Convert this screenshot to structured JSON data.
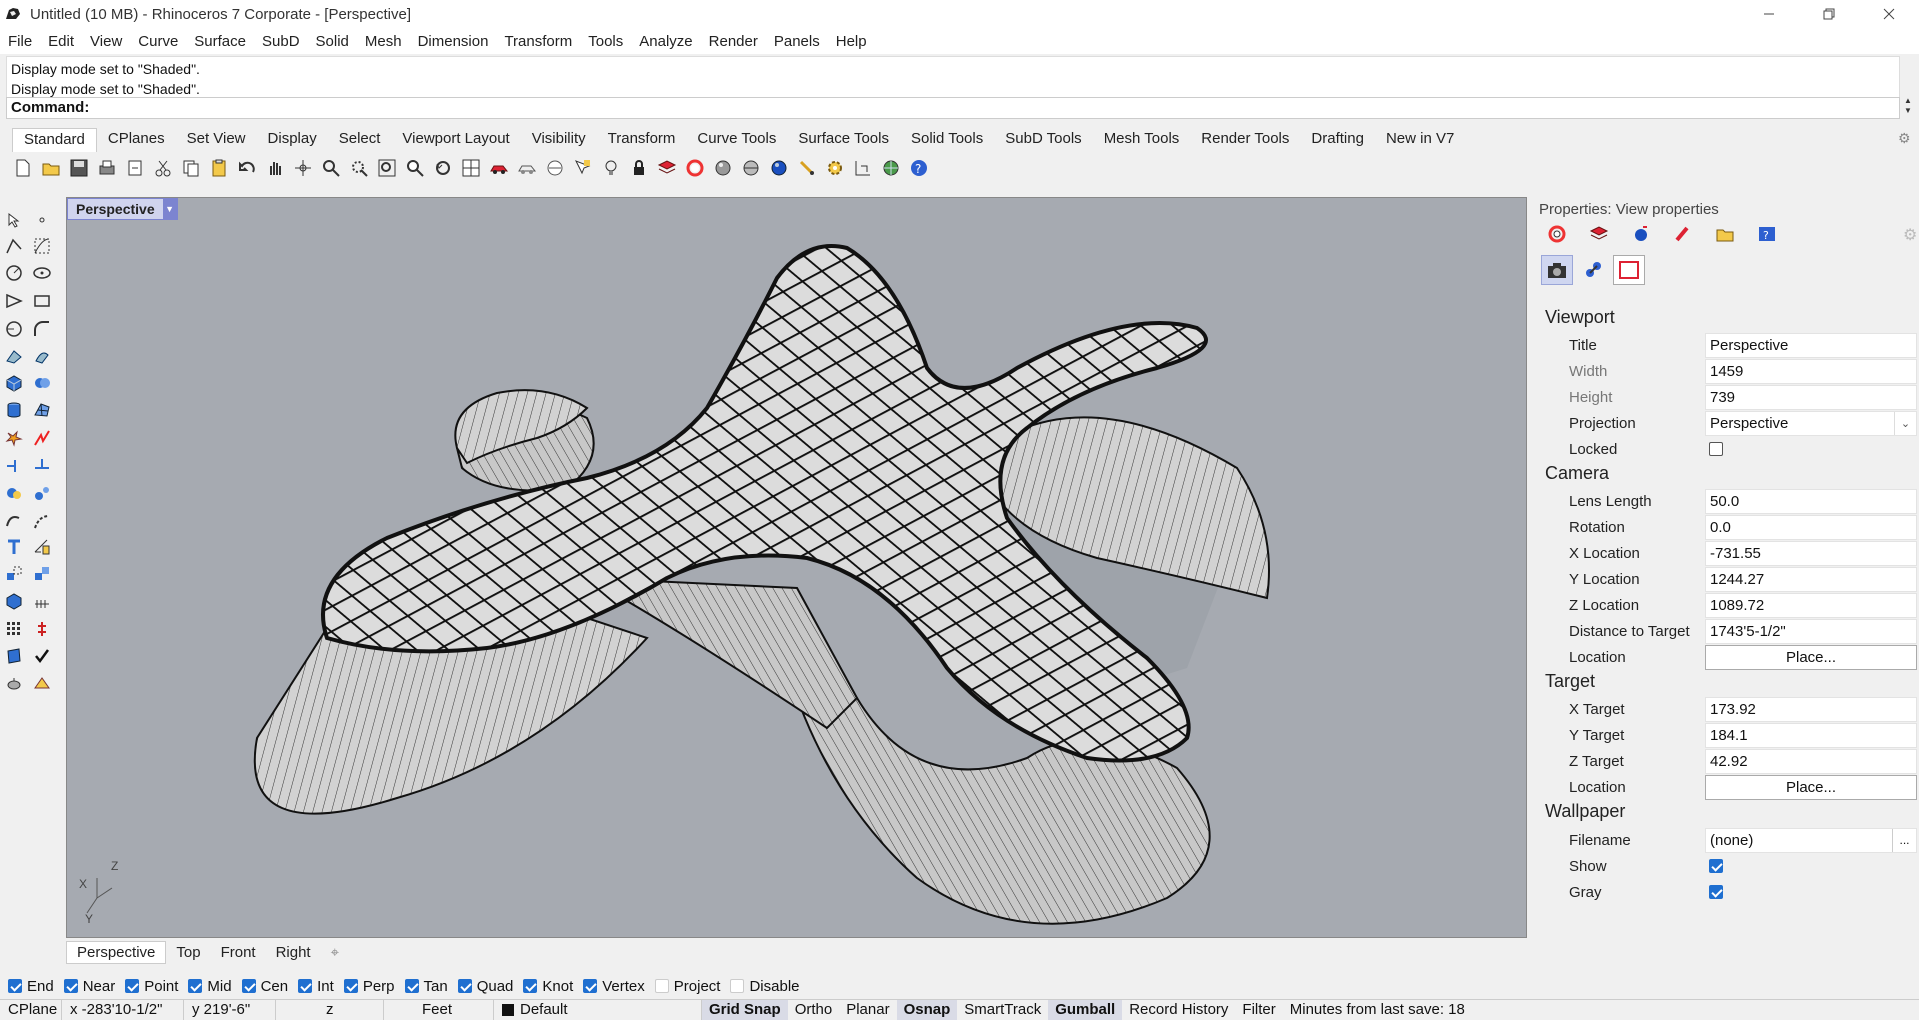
{
  "window": {
    "title": "Untitled (10 MB) - Rhinoceros 7 Corporate - [Perspective]"
  },
  "menu": [
    "File",
    "Edit",
    "View",
    "Curve",
    "Surface",
    "SubD",
    "Solid",
    "Mesh",
    "Dimension",
    "Transform",
    "Tools",
    "Analyze",
    "Render",
    "Panels",
    "Help"
  ],
  "command_history": [
    "Display mode set to \"Shaded\".",
    "Display mode set to \"Shaded\"."
  ],
  "command_prompt": "Command:",
  "toolbar_tabs": [
    "Standard",
    "CPlanes",
    "Set View",
    "Display",
    "Select",
    "Viewport Layout",
    "Visibility",
    "Transform",
    "Curve Tools",
    "Surface Tools",
    "Solid Tools",
    "SubD Tools",
    "Mesh Tools",
    "Render Tools",
    "Drafting",
    "New in V7"
  ],
  "viewport": {
    "label": "Perspective"
  },
  "viewport_tabs": [
    "Perspective",
    "Top",
    "Front",
    "Right"
  ],
  "axes": {
    "x": "X",
    "y": "Y",
    "z": "Z"
  },
  "properties": {
    "header": "Properties: View properties",
    "sections": {
      "viewport": "Viewport",
      "camera": "Camera",
      "target": "Target",
      "wallpaper": "Wallpaper"
    },
    "viewport_rows": {
      "title_label": "Title",
      "title_value": "Perspective",
      "width_label": "Width",
      "width_value": "1459",
      "height_label": "Height",
      "height_value": "739",
      "projection_label": "Projection",
      "projection_value": "Perspective",
      "locked_label": "Locked"
    },
    "camera_rows": {
      "lens_label": "Lens Length",
      "lens_value": "50.0",
      "rotation_label": "Rotation",
      "rotation_value": "0.0",
      "xloc_label": "X Location",
      "xloc_value": "-731.55",
      "yloc_label": "Y Location",
      "yloc_value": "1244.27",
      "zloc_label": "Z Location",
      "zloc_value": "1089.72",
      "dist_label": "Distance to Target",
      "dist_value": "1743'5-1/2\"",
      "loc_label": "Location",
      "loc_button": "Place..."
    },
    "target_rows": {
      "xt_label": "X Target",
      "xt_value": "173.92",
      "yt_label": "Y Target",
      "yt_value": "184.1",
      "zt_label": "Z Target",
      "zt_value": "42.92",
      "loc_label": "Location",
      "loc_button": "Place..."
    },
    "wallpaper_rows": {
      "file_label": "Filename",
      "file_value": "(none)",
      "file_button": "...",
      "show_label": "Show",
      "gray_label": "Gray"
    }
  },
  "osnap": {
    "items": [
      {
        "label": "End",
        "checked": true
      },
      {
        "label": "Near",
        "checked": true
      },
      {
        "label": "Point",
        "checked": true
      },
      {
        "label": "Mid",
        "checked": true
      },
      {
        "label": "Cen",
        "checked": true
      },
      {
        "label": "Int",
        "checked": true
      },
      {
        "label": "Perp",
        "checked": true
      },
      {
        "label": "Tan",
        "checked": true
      },
      {
        "label": "Quad",
        "checked": true
      },
      {
        "label": "Knot",
        "checked": true
      },
      {
        "label": "Vertex",
        "checked": true
      },
      {
        "label": "Project",
        "checked": false
      },
      {
        "label": "Disable",
        "checked": false
      }
    ]
  },
  "status": {
    "cplane": "CPlane",
    "x": "x -283'10-1/2\"",
    "y": "y 219'-6\"",
    "z": "z",
    "units": "Feet",
    "layer": "Default",
    "grid_snap": "Grid Snap",
    "ortho": "Ortho",
    "planar": "Planar",
    "osnap": "Osnap",
    "smarttrack": "SmartTrack",
    "gumball": "Gumball",
    "record_history": "Record History",
    "filter": "Filter",
    "last_save": "Minutes from last save: 18"
  }
}
